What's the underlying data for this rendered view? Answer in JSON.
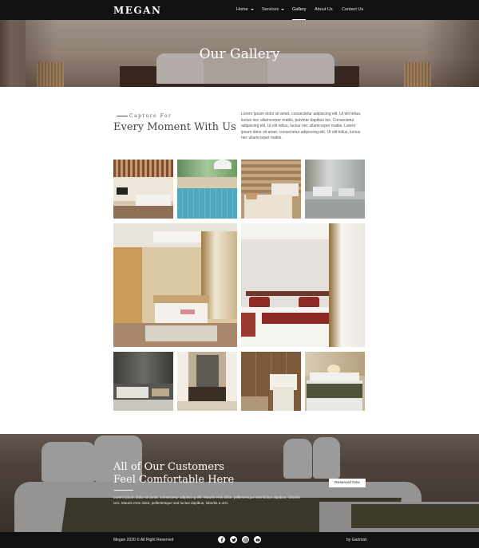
{
  "brand": {
    "logo": "MEGAN"
  },
  "nav": {
    "items": [
      {
        "label": "Home",
        "dropdown": true,
        "active": false
      },
      {
        "label": "Services",
        "dropdown": true,
        "active": false
      },
      {
        "label": "Gallery",
        "dropdown": false,
        "active": true
      },
      {
        "label": "About Us",
        "dropdown": false,
        "active": false
      },
      {
        "label": "Contact Us",
        "dropdown": false,
        "active": false
      }
    ]
  },
  "hero": {
    "title": "Our Gallery"
  },
  "intro": {
    "kicker": "Capture For",
    "heading": "Every Moment With Us",
    "body": "Lorem ipsum dolor sit amet, consectetur adipiscing elit. Ut elit tellus, luctus nec ullamcorper mattis, pulvinar dapibus leo. Consectetur adipiscing elit. Ut elit tellus, luctus nec ullamcorper mattis. Lorem ipsum dolor sit amet, consectetur adipiscing elit. Ut elit tellus, luctus nec ullamcorper mattis."
  },
  "gallery": {
    "images": [
      {
        "subject": "hotel-room-wood-ceiling"
      },
      {
        "subject": "swimming-pool"
      },
      {
        "subject": "stone-wall-bedroom"
      },
      {
        "subject": "grey-lounge-room"
      },
      {
        "subject": "beige-bedroom"
      },
      {
        "subject": "red-throw-bedroom"
      },
      {
        "subject": "dark-living-room"
      },
      {
        "subject": "dining-hall"
      },
      {
        "subject": "wooden-wardrobe-room"
      },
      {
        "subject": "olive-throw-bedroom"
      }
    ]
  },
  "banner": {
    "title_line1": "All of Our Customers",
    "title_line2": "Feel Comfortable Here",
    "text": "Lorem ipsum dolor sit amet, consectetur adipiscing elit. Mauris eros dolor, pellentesque sed luctus dapibus, lobortis orci. Mauris eros dolor, pellentesque sed luctus dapibus, lobortis a orci.",
    "button": "Reserved Now"
  },
  "footer": {
    "copyright": "Megan 2020 © All Right Reserved",
    "credit": "by Gariman",
    "social": [
      "facebook-icon",
      "twitter-icon",
      "instagram-icon",
      "youtube-icon"
    ]
  },
  "colors": {
    "nav_bg": "#111111",
    "footer_bg": "#111111",
    "accent_text": "#444444",
    "button_bg": "#ffffff"
  }
}
